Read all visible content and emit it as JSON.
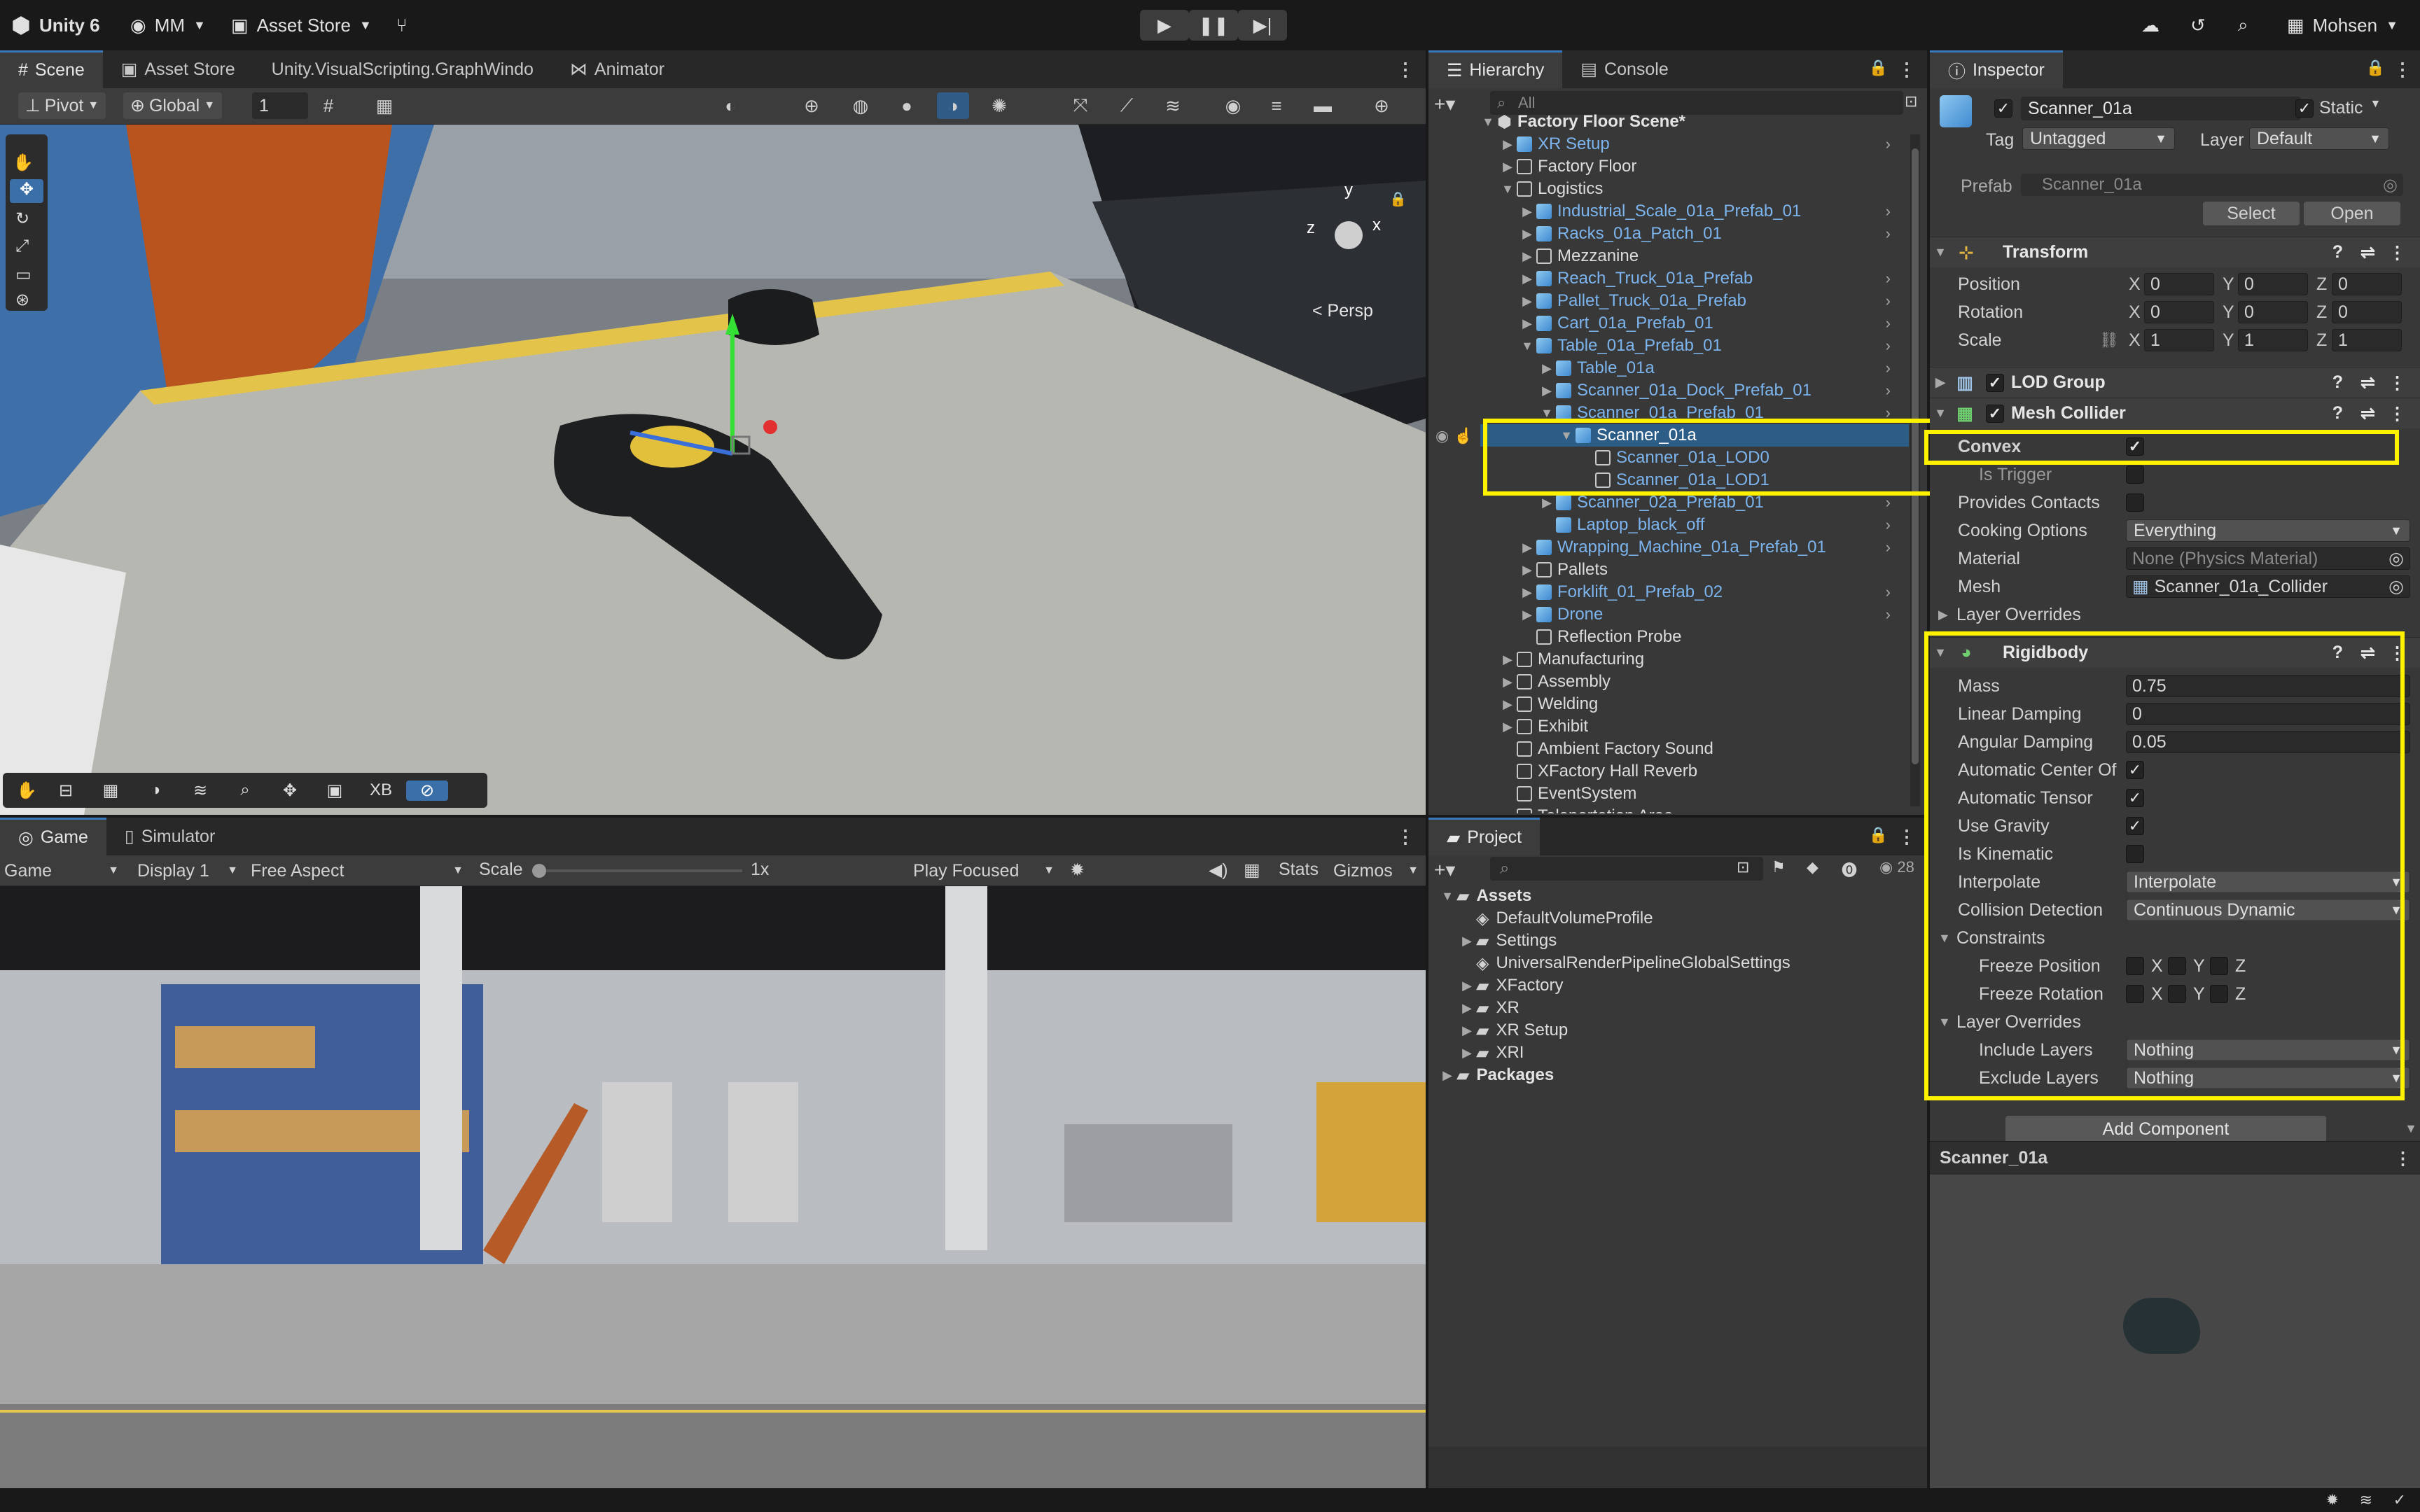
{
  "topbar": {
    "app": "Unity 6",
    "account": "MM",
    "asset_store": "Asset Store",
    "user": "Mohsen"
  },
  "scene": {
    "tabs": [
      "Scene",
      "Asset Store",
      "Unity.VisualScripting.GraphWindo",
      "Animator"
    ],
    "pivot": "Pivot",
    "global": "Global",
    "grid_value": "1",
    "persp": "Persp",
    "gizmo_axes": {
      "y": "y",
      "x": "x",
      "z": "z"
    },
    "overlay_xb": "XB"
  },
  "game": {
    "tabs": [
      "Game",
      "Simulator"
    ],
    "mode": "Game",
    "display": "Display 1",
    "aspect": "Free Aspect",
    "scale_label": "Scale",
    "scale_value": "1x",
    "play_focused": "Play Focused",
    "stats": "Stats",
    "gizmos": "Gizmos"
  },
  "hierarchy": {
    "tabs": [
      "Hierarchy",
      "Console"
    ],
    "search_placeholder": "All",
    "rows": [
      {
        "label": "Factory Floor Scene*",
        "style": "white"
      },
      {
        "label": "XR Setup",
        "style": "blue"
      },
      {
        "label": "Factory Floor",
        "style": "white"
      },
      {
        "label": "Logistics",
        "style": "white"
      },
      {
        "label": "Industrial_Scale_01a_Prefab_01",
        "style": "blue"
      },
      {
        "label": "Racks_01a_Patch_01",
        "style": "blue"
      },
      {
        "label": "Mezzanine",
        "style": "white"
      },
      {
        "label": "Reach_Truck_01a_Prefab",
        "style": "blue"
      },
      {
        "label": "Pallet_Truck_01a_Prefab",
        "style": "blue"
      },
      {
        "label": "Cart_01a_Prefab_01",
        "style": "blue"
      },
      {
        "label": "Table_01a_Prefab_01",
        "style": "blue"
      },
      {
        "label": "Table_01a",
        "style": "blue"
      },
      {
        "label": "Scanner_01a_Dock_Prefab_01",
        "style": "blue"
      },
      {
        "label": "Scanner_01a_Prefab_01",
        "style": "blue"
      },
      {
        "label": "Scanner_01a",
        "style": "selected"
      },
      {
        "label": "Scanner_01a_LOD0",
        "style": "blue"
      },
      {
        "label": "Scanner_01a_LOD1",
        "style": "blue"
      },
      {
        "label": "Scanner_02a_Prefab_01",
        "style": "blue"
      },
      {
        "label": "Laptop_black_off",
        "style": "blue"
      },
      {
        "label": "Wrapping_Machine_01a_Prefab_01",
        "style": "blue"
      },
      {
        "label": "Pallets",
        "style": "white"
      },
      {
        "label": "Forklift_01_Prefab_02",
        "style": "blue"
      },
      {
        "label": "Drone",
        "style": "blue"
      },
      {
        "label": "Reflection Probe",
        "style": "white"
      },
      {
        "label": "Manufacturing",
        "style": "white"
      },
      {
        "label": "Assembly",
        "style": "white"
      },
      {
        "label": "Welding",
        "style": "white"
      },
      {
        "label": "Exhibit",
        "style": "white"
      },
      {
        "label": "Ambient Factory Sound",
        "style": "white"
      },
      {
        "label": "XFactory Hall Reverb",
        "style": "white"
      },
      {
        "label": "EventSystem",
        "style": "white"
      },
      {
        "label": "Teleportation Area",
        "style": "white"
      }
    ]
  },
  "project": {
    "tab": "Project",
    "count": "28",
    "items": [
      {
        "label": "Assets",
        "bold": true
      },
      {
        "label": "DefaultVolumeProfile",
        "bold": false
      },
      {
        "label": "Settings",
        "bold": false
      },
      {
        "label": "UniversalRenderPipelineGlobalSettings",
        "bold": false
      },
      {
        "label": "XFactory",
        "bold": false
      },
      {
        "label": "XR",
        "bold": false
      },
      {
        "label": "XR Setup",
        "bold": false
      },
      {
        "label": "XRI",
        "bold": false
      },
      {
        "label": "Packages",
        "bold": true
      }
    ]
  },
  "inspector": {
    "tab": "Inspector",
    "object_name": "Scanner_01a",
    "static": "Static",
    "tag_label": "Tag",
    "tag_value": "Untagged",
    "layer_label": "Layer",
    "layer_value": "Default",
    "prefab_label": "Prefab",
    "prefab_value": "Scanner_01a",
    "select_btn": "Select",
    "open_btn": "Open",
    "transform": {
      "title": "Transform",
      "position_label": "Position",
      "rotation_label": "Rotation",
      "scale_label": "Scale",
      "position": [
        "0",
        "0",
        "0"
      ],
      "rotation": [
        "0",
        "0",
        "0"
      ],
      "scale": [
        "1",
        "1",
        "1"
      ],
      "axes": [
        "X",
        "Y",
        "Z"
      ]
    },
    "lod_group": "LOD Group",
    "mesh_collider": {
      "title": "Mesh Collider",
      "convex": "Convex",
      "is_trigger": "Is Trigger",
      "provides_contacts": "Provides Contacts",
      "cooking_label": "Cooking Options",
      "cooking_value": "Everything",
      "material_label": "Material",
      "material_value": "None (Physics Material)",
      "mesh_label": "Mesh",
      "mesh_value": "Scanner_01a_Collider",
      "layer_overrides": "Layer Overrides"
    },
    "rigidbody": {
      "title": "Rigidbody",
      "mass_label": "Mass",
      "mass": "0.75",
      "linear_damping_label": "Linear Damping",
      "linear_damping": "0",
      "angular_damping_label": "Angular Damping",
      "angular_damping": "0.05",
      "auto_center": "Automatic Center Of",
      "auto_tensor": "Automatic Tensor",
      "use_gravity": "Use Gravity",
      "is_kinematic": "Is Kinematic",
      "interpolate_label": "Interpolate",
      "interpolate_value": "Interpolate",
      "collision_label": "Collision Detection",
      "collision_value": "Continuous Dynamic",
      "constraints": "Constraints",
      "freeze_position": "Freeze Position",
      "freeze_rotation": "Freeze Rotation",
      "layer_overrides": "Layer Overrides",
      "include_label": "Include Layers",
      "include_value": "Nothing",
      "exclude_label": "Exclude Layers",
      "exclude_value": "Nothing"
    },
    "add_component": "Add Component",
    "preview_title": "Scanner_01a"
  },
  "colors": {
    "highlight": "#fff200",
    "selection": "#2c5d87",
    "prefab_blue": "#7cb4ee"
  }
}
